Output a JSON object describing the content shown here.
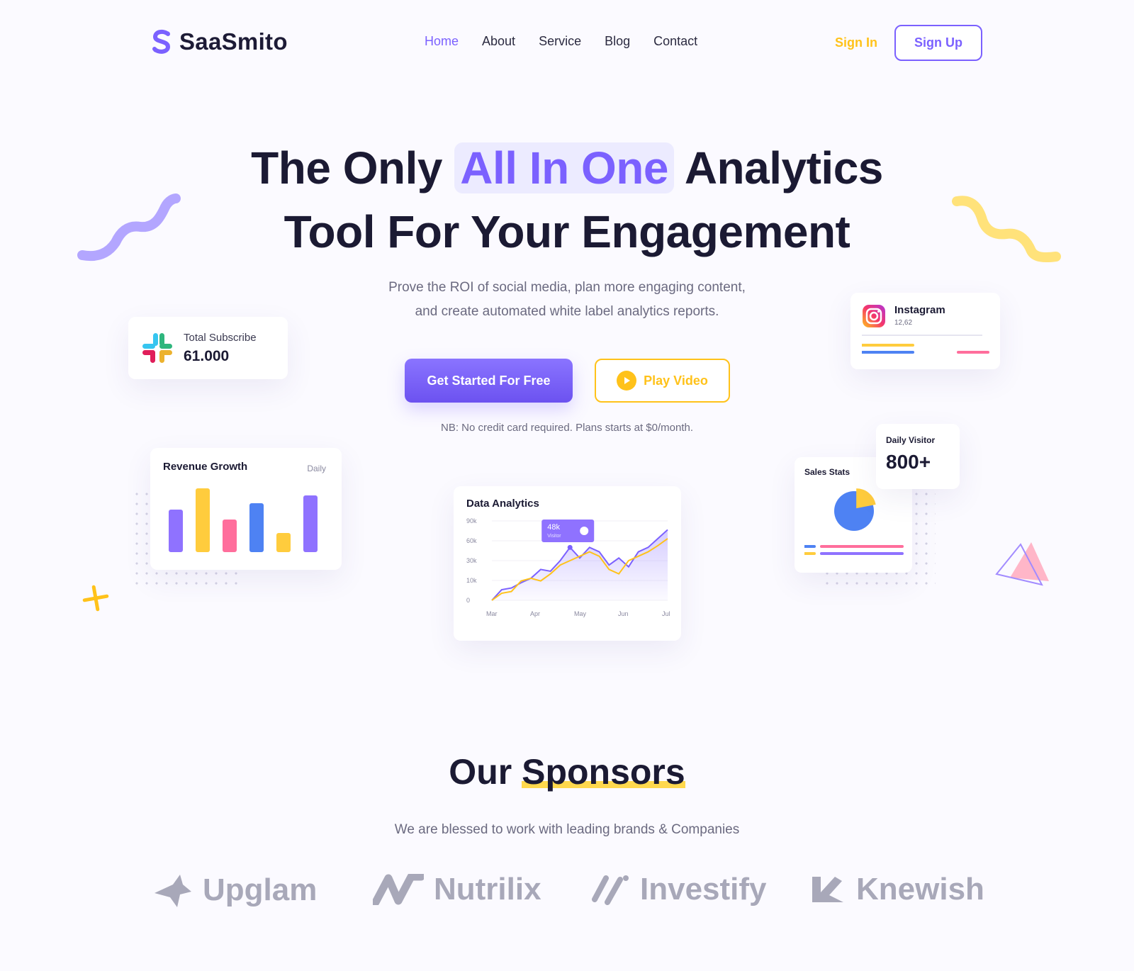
{
  "header": {
    "logo_text": "SaaSmito",
    "nav": [
      {
        "label": "Home",
        "active": true
      },
      {
        "label": "About",
        "active": false
      },
      {
        "label": "Service",
        "active": false
      },
      {
        "label": "Blog",
        "active": false
      },
      {
        "label": "Contact",
        "active": false
      }
    ],
    "sign_in": "Sign In",
    "sign_up": "Sign Up"
  },
  "hero": {
    "title_part1": "The Only",
    "title_highlight": "All In One",
    "title_part2": "Analytics",
    "title_line2": "Tool For Your Engagement",
    "subtitle_line1": "Prove the ROI of social media, plan more engaging content,",
    "subtitle_line2": "and create automated white label analytics reports.",
    "primary_button": "Get Started For Free",
    "secondary_button": "Play Video",
    "note": "NB: No credit card required. Plans starts at $0/month."
  },
  "cards": {
    "subscribe": {
      "label": "Total Subscribe",
      "value": "61.000"
    },
    "instagram": {
      "title": "Instagram",
      "value": "12,62"
    },
    "revenue": {
      "title": "Revenue Growth",
      "period": "Daily"
    },
    "analytics": {
      "title": "Data Analytics",
      "tooltip_value": "48k",
      "tooltip_label": "Visitor"
    },
    "sales": {
      "title": "Sales Stats",
      "pie_fraction": 0.22
    },
    "visitor": {
      "title": "Daily Visitor",
      "value": "800+"
    }
  },
  "chart_data": [
    {
      "type": "bar",
      "title": "Revenue Growth",
      "values": [
        60,
        90,
        46,
        69,
        27,
        80
      ],
      "colors": [
        "#8f72ff",
        "#ffcc3d",
        "#ff6e9c",
        "#4e82f3",
        "#ffcc3d",
        "#8f72ff"
      ],
      "ylim": [
        0,
        100
      ]
    },
    {
      "type": "area",
      "title": "Data Analytics",
      "x_ticks": [
        "Mar",
        "Apr",
        "May",
        "Jun",
        "Jul"
      ],
      "y_ticks": [
        "90k",
        "60k",
        "30k",
        "10k",
        "0"
      ],
      "series": [
        {
          "color": "#7b61ff",
          "values": [
            0,
            12,
            14,
            20,
            25,
            35,
            33,
            45,
            60,
            48,
            60,
            55,
            40,
            48,
            38,
            55,
            60,
            70,
            80
          ]
        },
        {
          "color": "#ffc21a",
          "values": [
            0,
            8,
            10,
            22,
            25,
            22,
            30,
            40,
            45,
            50,
            55,
            50,
            35,
            30,
            45,
            50,
            55,
            62,
            70
          ]
        }
      ],
      "ylim": [
        0,
        90
      ]
    }
  ],
  "sponsors": {
    "title_part1": "Our",
    "title_highlight": "Sponsors",
    "subtitle": "We are blessed to work with leading brands & Companies",
    "brands": [
      "Upglam",
      "Nutrilix",
      "Investify",
      "Knewish"
    ]
  },
  "colors": {
    "primary": "#7b61ff",
    "accent": "#ffc21a",
    "text": "#1b1a33"
  }
}
